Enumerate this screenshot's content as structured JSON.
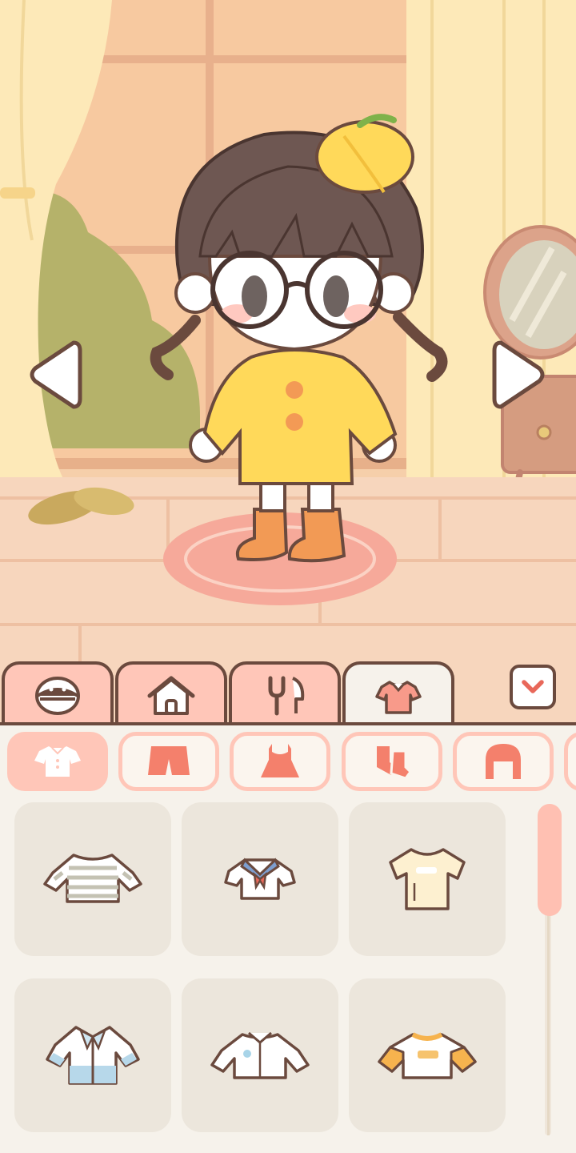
{
  "scene": {
    "nav": {
      "prev": "previous-outfit",
      "next": "next-outfit"
    }
  },
  "tabs": [
    {
      "name": "character",
      "icon": "face-icon",
      "active": false
    },
    {
      "name": "room",
      "icon": "house-icon",
      "active": false
    },
    {
      "name": "food",
      "icon": "fork-knife-icon",
      "active": false
    },
    {
      "name": "clothes",
      "icon": "shirt-icon",
      "active": true
    }
  ],
  "collapse_icon": "chevron-down-icon",
  "subtabs": [
    {
      "name": "tops",
      "icon": "shirt-icon",
      "active": true
    },
    {
      "name": "bottoms",
      "icon": "shorts-icon",
      "active": false
    },
    {
      "name": "dresses",
      "icon": "dress-icon",
      "active": false
    },
    {
      "name": "shoes",
      "icon": "socks-icon",
      "active": false
    },
    {
      "name": "hair",
      "icon": "hair-icon",
      "active": false
    }
  ],
  "items": [
    {
      "name": "striped-long-sleeve",
      "icon": "striped-shirt-icon"
    },
    {
      "name": "sailor-top",
      "icon": "sailor-shirt-icon"
    },
    {
      "name": "cream-tshirt",
      "icon": "tshirt-icon"
    },
    {
      "name": "blue-jacket",
      "icon": "jacket-icon"
    },
    {
      "name": "white-shirt",
      "icon": "collar-shirt-icon"
    },
    {
      "name": "orange-sleeve-tee",
      "icon": "raglan-shirt-icon"
    }
  ],
  "colors": {
    "outline": "#6b4a3e",
    "tab_pink": "#ffc6b8",
    "panel_bg": "#f6f2eb",
    "card_bg": "#ece6dc",
    "accent_red": "#e8685a",
    "raincoat_yellow": "#ffd95a"
  }
}
